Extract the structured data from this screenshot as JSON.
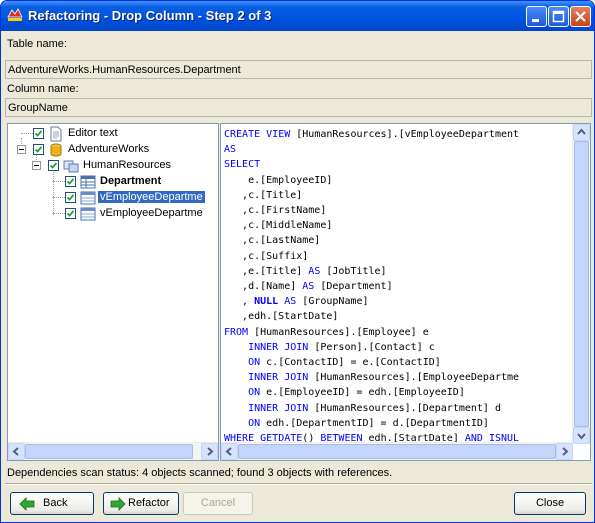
{
  "window": {
    "title": "Refactoring - Drop Column - Step 2 of 3",
    "app_icon": "red-gate-logo-icon"
  },
  "fields": {
    "table_label": "Table name:",
    "table_value": "AdventureWorks.HumanResources.Department",
    "column_label": "Column name:",
    "column_value": "GroupName"
  },
  "tree": {
    "items": [
      {
        "label": "Editor text",
        "checked": true,
        "icon": "document-icon"
      },
      {
        "label": "AdventureWorks",
        "checked": true,
        "icon": "database-icon"
      },
      {
        "label": "HumanResources",
        "checked": true,
        "icon": "schema-icon"
      },
      {
        "label": "Department",
        "checked": true,
        "icon": "table-icon"
      },
      {
        "label": "vEmployeeDepartme",
        "checked": true,
        "icon": "view-icon",
        "selected": true
      },
      {
        "label": "vEmployeeDepartme",
        "checked": true,
        "icon": "view-icon"
      }
    ]
  },
  "code": {
    "lines": [
      "CREATE VIEW [HumanResources].[vEmployeeDepartment",
      "AS",
      "SELECT",
      "    e.[EmployeeID]",
      "   ,c.[Title]",
      "   ,c.[FirstName]",
      "   ,c.[MiddleName]",
      "   ,c.[LastName]",
      "   ,c.[Suffix]",
      "   ,e.[Title] AS [JobTitle]",
      "   ,d.[Name] AS [Department]",
      "   , NULL AS [GroupName]",
      "   ,edh.[StartDate]",
      "FROM [HumanResources].[Employee] e",
      "    INNER JOIN [Person].[Contact] c",
      "    ON c.[ContactID] = e.[ContactID]",
      "    INNER JOIN [HumanResources].[EmployeeDepartme",
      "    ON e.[EmployeeID] = edh.[EmployeeID]",
      "    INNER JOIN [HumanResources].[Department] d",
      "    ON edh.[DepartmentID] = d.[DepartmentID]",
      "WHERE GETDATE() BETWEEN edh.[StartDate] AND ISNUL"
    ]
  },
  "status": {
    "text": "Dependencies scan status: 4 objects scanned; found 3 objects with references."
  },
  "buttons": {
    "back": "Back",
    "refactor": "Refactor",
    "cancel": "Cancel",
    "close": "Close"
  },
  "colors": {
    "keyword": "#0000ff",
    "selection": "#316ac5",
    "titlebar": "#0054e3"
  }
}
